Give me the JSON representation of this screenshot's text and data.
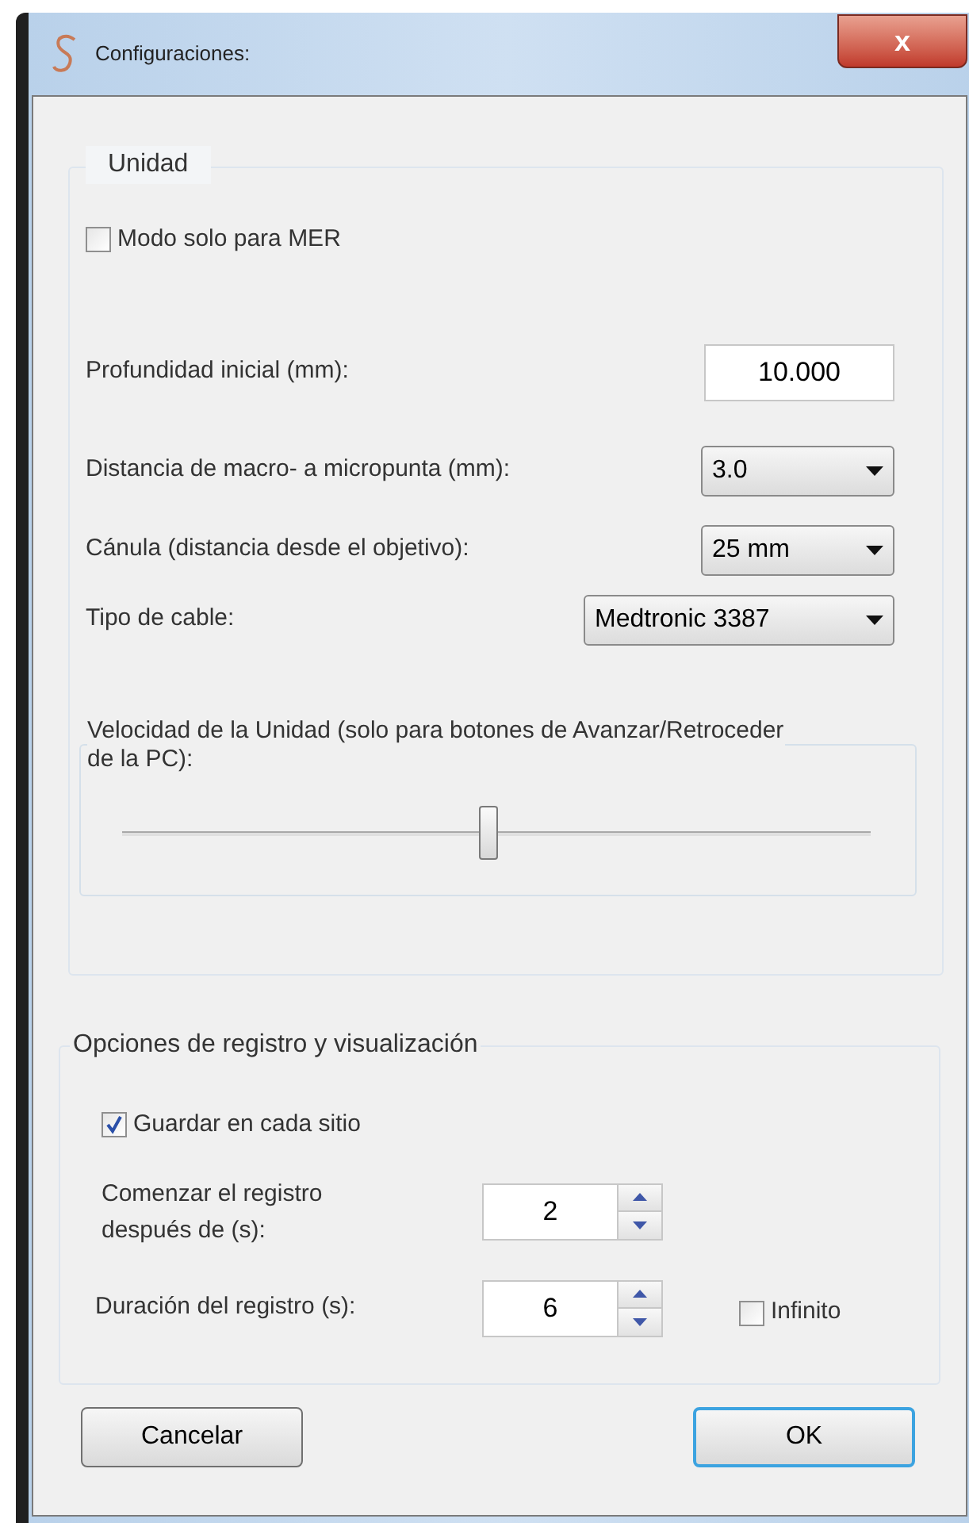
{
  "window": {
    "title": "Configuraciones:",
    "close": "x"
  },
  "unidad": {
    "legend": "Unidad",
    "mer_checkbox": {
      "label": "Modo solo para MER",
      "checked": false
    },
    "fields": [
      {
        "kind": "text",
        "label": "Profundidad inicial (mm):",
        "value": "10.000"
      },
      {
        "kind": "select",
        "label": "Distancia de macro- a micropunta (mm):",
        "value": "3.0"
      },
      {
        "kind": "select",
        "label": "Cánula (distancia desde el objetivo):",
        "value": "25 mm"
      },
      {
        "kind": "select",
        "label": "Tipo de cable:",
        "value": "Medtronic 3387"
      }
    ],
    "speed": {
      "label": "Velocidad de la Unidad (solo para botones de Avanzar/Retroceder de la PC):",
      "level": 0.49
    }
  },
  "registro": {
    "legend": "Opciones de registro y visualización",
    "save_checkbox": {
      "label": "Guardar en cada sitio",
      "checked": true
    },
    "start": {
      "label": "Comenzar el registro después de (s):",
      "value": "2"
    },
    "duration": {
      "label": "Duración del registro (s):",
      "value": "6"
    },
    "infinite_checkbox": {
      "label": "Infinito",
      "checked": false
    }
  },
  "buttons": [
    {
      "label": "Cancelar",
      "default": false
    },
    {
      "label": "OK",
      "default": true
    }
  ]
}
